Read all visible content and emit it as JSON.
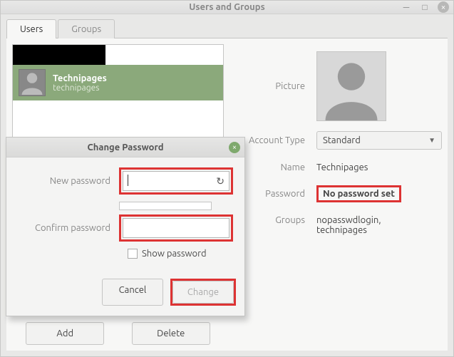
{
  "window": {
    "title": "Users and Groups"
  },
  "tabs": {
    "users": "Users",
    "groups": "Groups"
  },
  "user_list": {
    "selected": {
      "display_name": "Technipages",
      "username": "technipages"
    }
  },
  "buttons": {
    "add": "Add",
    "delete": "Delete"
  },
  "detail_labels": {
    "picture": "Picture",
    "account_type": "Account Type",
    "name": "Name",
    "password": "Password",
    "groups": "Groups"
  },
  "detail_values": {
    "account_type": "Standard",
    "name": "Technipages",
    "password": "No password set",
    "groups": "nopasswdlogin, technipages"
  },
  "modal": {
    "title": "Change Password",
    "new_password_label": "New password",
    "confirm_password_label": "Confirm password",
    "show_password_label": "Show password",
    "cancel": "Cancel",
    "change": "Change",
    "new_password_value": "",
    "confirm_password_value": ""
  }
}
